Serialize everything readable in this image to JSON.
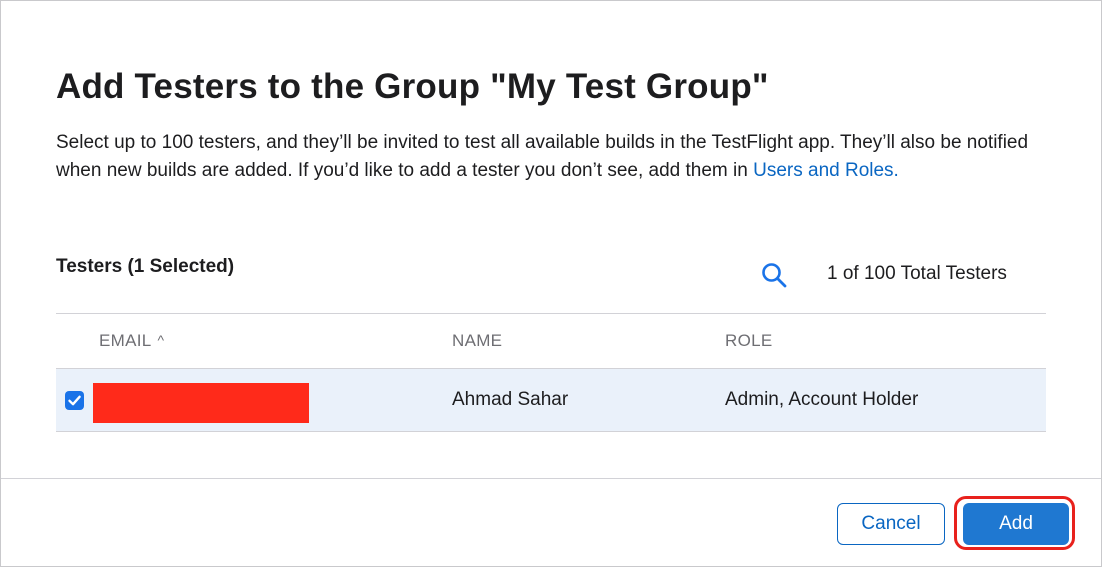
{
  "dialog": {
    "title": "Add Testers to the Group \"My Test Group\"",
    "description_text": "Select up to 100 testers, and they’ll be invited to test all available builds in the TestFlight app. They’ll also be notified when new builds are added. If you’d like to add a tester you don’t see, add them in ",
    "description_link": "Users and Roles.",
    "link_color": "#0a66c2"
  },
  "testers": {
    "label": "Testers (1 Selected)",
    "search_icon": "search-icon",
    "count_text": "1 of 100 Total Testers"
  },
  "table": {
    "columns": {
      "email": "EMAIL",
      "email_sort_icon": "chevron-up-icon",
      "email_sort_glyph": "^",
      "name": "NAME",
      "role": "ROLE"
    },
    "rows": [
      {
        "selected": true,
        "email": "",
        "email_redacted": true,
        "name": "Ahmad Sahar",
        "role": "Admin, Account Holder"
      }
    ]
  },
  "footer": {
    "cancel_label": "Cancel",
    "add_label": "Add",
    "accent_color": "#1f78d1",
    "highlight_color": "#e8211c"
  }
}
